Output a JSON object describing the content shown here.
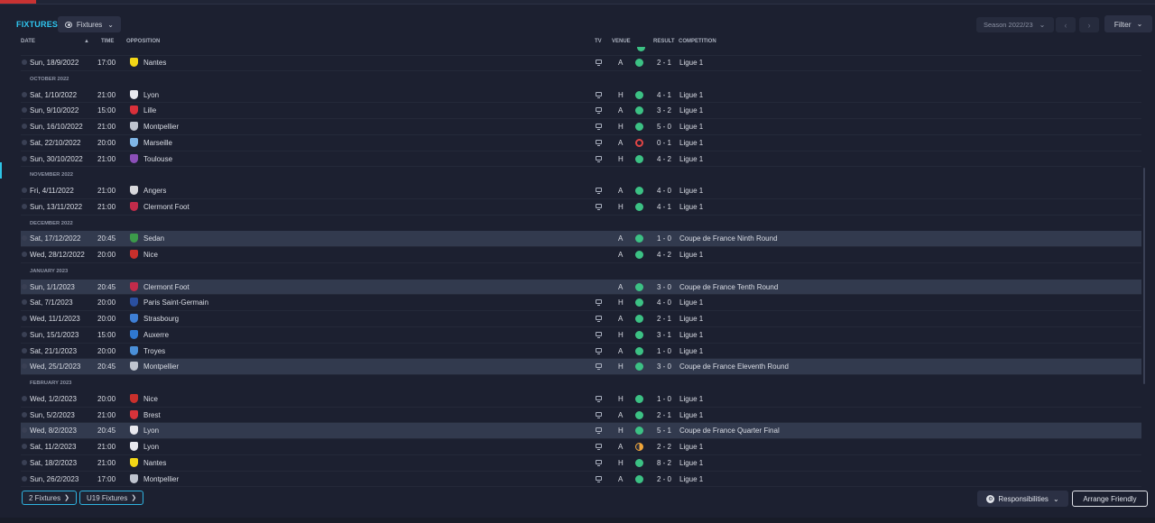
{
  "header": {
    "title": "FIXTURES",
    "view_dropdown": "Fixtures",
    "season": "Season 2022/23",
    "filter": "Filter"
  },
  "columns": {
    "date": "DATE",
    "time": "TIME",
    "opposition": "OPPOSITION",
    "tv": "TV",
    "venue": "VENUE",
    "result": "RESULT",
    "competition": "COMPETITION"
  },
  "colors": {
    "accent": "#2fc6f0",
    "win": "#3cc184",
    "loss": "#e04545",
    "draw": "#f0a63a",
    "highlight": "#323a4e"
  },
  "fixtures": [
    {
      "type": "match",
      "date": "Sun, 18/9/2022",
      "time": "17:00",
      "opp": "Nantes",
      "crest": "#f2d616",
      "tv": true,
      "venue": "A",
      "outcome": "W",
      "score": "2 - 1",
      "comp": "Ligue 1",
      "hl": false
    },
    {
      "type": "month",
      "label": "OCTOBER 2022"
    },
    {
      "type": "match",
      "date": "Sat, 1/10/2022",
      "time": "21:00",
      "opp": "Lyon",
      "crest": "#e8e8ee",
      "tv": true,
      "venue": "H",
      "outcome": "W",
      "score": "4 - 1",
      "comp": "Ligue 1",
      "hl": false
    },
    {
      "type": "match",
      "date": "Sun, 9/10/2022",
      "time": "15:00",
      "opp": "Lille",
      "crest": "#d9303a",
      "tv": true,
      "venue": "A",
      "outcome": "W",
      "score": "3 - 2",
      "comp": "Ligue 1",
      "hl": false
    },
    {
      "type": "match",
      "date": "Sun, 16/10/2022",
      "time": "21:00",
      "opp": "Montpellier",
      "crest": "#bfc4cf",
      "tv": true,
      "venue": "H",
      "outcome": "W",
      "score": "5 - 0",
      "comp": "Ligue 1",
      "hl": false
    },
    {
      "type": "match",
      "date": "Sat, 22/10/2022",
      "time": "20:00",
      "opp": "Marseille",
      "crest": "#7fb5e6",
      "tv": true,
      "venue": "A",
      "outcome": "L",
      "score": "0 - 1",
      "comp": "Ligue 1",
      "hl": false
    },
    {
      "type": "match",
      "date": "Sun, 30/10/2022",
      "time": "21:00",
      "opp": "Toulouse",
      "crest": "#8b4fb8",
      "tv": true,
      "venue": "H",
      "outcome": "W",
      "score": "4 - 2",
      "comp": "Ligue 1",
      "hl": false
    },
    {
      "type": "month",
      "label": "NOVEMBER 2022"
    },
    {
      "type": "match",
      "date": "Fri, 4/11/2022",
      "time": "21:00",
      "opp": "Angers",
      "crest": "#d8d8dc",
      "tv": true,
      "venue": "A",
      "outcome": "W",
      "score": "4 - 0",
      "comp": "Ligue 1",
      "hl": false
    },
    {
      "type": "match",
      "date": "Sun, 13/11/2022",
      "time": "21:00",
      "opp": "Clermont Foot",
      "crest": "#c22b4a",
      "tv": true,
      "venue": "H",
      "outcome": "W",
      "score": "4 - 1",
      "comp": "Ligue 1",
      "hl": false
    },
    {
      "type": "month",
      "label": "DECEMBER 2022"
    },
    {
      "type": "match",
      "date": "Sat, 17/12/2022",
      "time": "20:45",
      "opp": "Sedan",
      "crest": "#3c9a4a",
      "tv": false,
      "venue": "A",
      "outcome": "W",
      "score": "1 - 0",
      "comp": "Coupe de France Ninth Round",
      "hl": true
    },
    {
      "type": "match",
      "date": "Wed, 28/12/2022",
      "time": "20:00",
      "opp": "Nice",
      "crest": "#c9302c",
      "tv": false,
      "venue": "A",
      "outcome": "W",
      "score": "4 - 2",
      "comp": "Ligue 1",
      "hl": false
    },
    {
      "type": "month",
      "label": "JANUARY 2023"
    },
    {
      "type": "match",
      "date": "Sun, 1/1/2023",
      "time": "20:45",
      "opp": "Clermont Foot",
      "crest": "#c22b4a",
      "tv": false,
      "venue": "A",
      "outcome": "W",
      "score": "3 - 0",
      "comp": "Coupe de France Tenth Round",
      "hl": true
    },
    {
      "type": "match",
      "date": "Sat, 7/1/2023",
      "time": "20:00",
      "opp": "Paris Saint-Germain",
      "crest": "#2a4fa0",
      "tv": true,
      "venue": "H",
      "outcome": "W",
      "score": "4 - 0",
      "comp": "Ligue 1",
      "hl": false
    },
    {
      "type": "match",
      "date": "Wed, 11/1/2023",
      "time": "20:00",
      "opp": "Strasbourg",
      "crest": "#3e7fd6",
      "tv": true,
      "venue": "A",
      "outcome": "W",
      "score": "2 - 1",
      "comp": "Ligue 1",
      "hl": false
    },
    {
      "type": "match",
      "date": "Sun, 15/1/2023",
      "time": "15:00",
      "opp": "Auxerre",
      "crest": "#2f78d0",
      "tv": true,
      "venue": "H",
      "outcome": "W",
      "score": "3 - 1",
      "comp": "Ligue 1",
      "hl": false
    },
    {
      "type": "match",
      "date": "Sat, 21/1/2023",
      "time": "20:00",
      "opp": "Troyes",
      "crest": "#4a8fd8",
      "tv": true,
      "venue": "A",
      "outcome": "W",
      "score": "1 - 0",
      "comp": "Ligue 1",
      "hl": false
    },
    {
      "type": "match",
      "date": "Wed, 25/1/2023",
      "time": "20:45",
      "opp": "Montpellier",
      "crest": "#bfc4cf",
      "tv": true,
      "venue": "H",
      "outcome": "W",
      "score": "3 - 0",
      "comp": "Coupe de France Eleventh Round",
      "hl": true
    },
    {
      "type": "month",
      "label": "FEBRUARY 2023"
    },
    {
      "type": "match",
      "date": "Wed, 1/2/2023",
      "time": "20:00",
      "opp": "Nice",
      "crest": "#c9302c",
      "tv": true,
      "venue": "H",
      "outcome": "W",
      "score": "1 - 0",
      "comp": "Ligue 1",
      "hl": false
    },
    {
      "type": "match",
      "date": "Sun, 5/2/2023",
      "time": "21:00",
      "opp": "Brest",
      "crest": "#d8333a",
      "tv": true,
      "venue": "A",
      "outcome": "W",
      "score": "2 - 1",
      "comp": "Ligue 1",
      "hl": false
    },
    {
      "type": "match",
      "date": "Wed, 8/2/2023",
      "time": "20:45",
      "opp": "Lyon",
      "crest": "#e8e8ee",
      "tv": true,
      "venue": "H",
      "outcome": "W",
      "score": "5 - 1",
      "comp": "Coupe de France Quarter Final",
      "hl": true
    },
    {
      "type": "match",
      "date": "Sat, 11/2/2023",
      "time": "21:00",
      "opp": "Lyon",
      "crest": "#e8e8ee",
      "tv": true,
      "venue": "A",
      "outcome": "D",
      "score": "2 - 2",
      "comp": "Ligue 1",
      "hl": false
    },
    {
      "type": "match",
      "date": "Sat, 18/2/2023",
      "time": "21:00",
      "opp": "Nantes",
      "crest": "#f2d616",
      "tv": true,
      "venue": "H",
      "outcome": "W",
      "score": "8 - 2",
      "comp": "Ligue 1",
      "hl": false
    },
    {
      "type": "match",
      "date": "Sun, 26/2/2023",
      "time": "17:00",
      "opp": "Montpellier",
      "crest": "#bfc4cf",
      "tv": true,
      "venue": "A",
      "outcome": "W",
      "score": "2 - 0",
      "comp": "Ligue 1",
      "hl": false
    }
  ],
  "footer": {
    "fixtures2": "2 Fixtures",
    "u19": "U19 Fixtures",
    "responsibilities": "Responsibilities",
    "arrange": "Arrange Friendly"
  }
}
